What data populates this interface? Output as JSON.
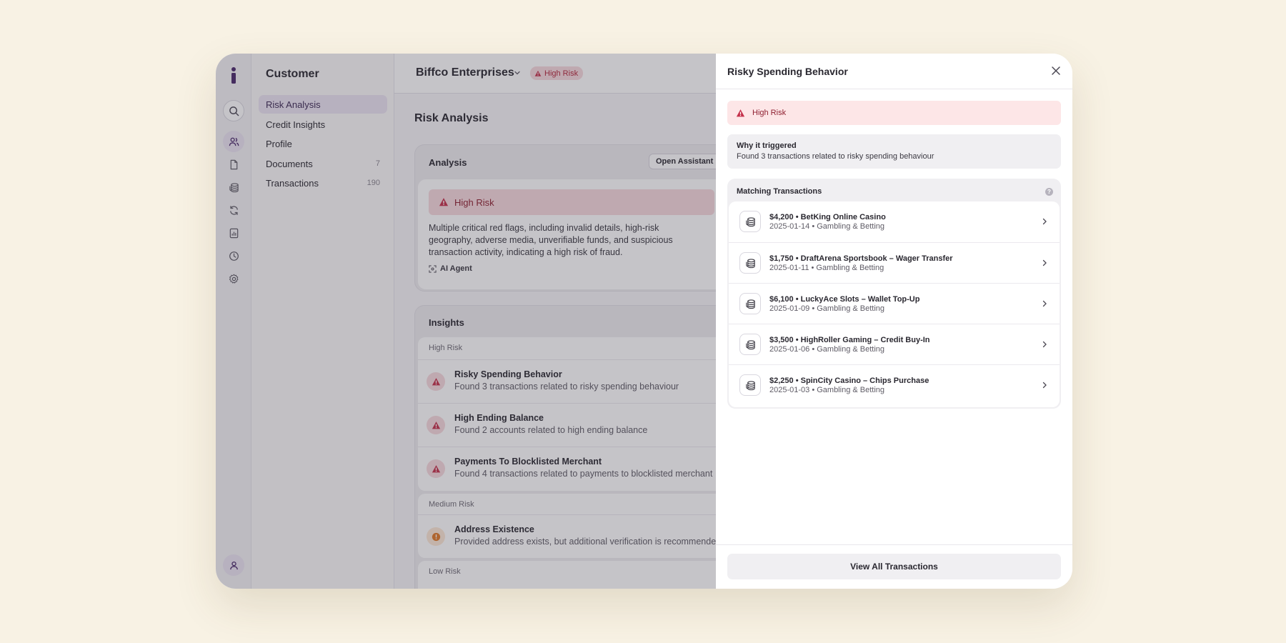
{
  "rail": {
    "icons": [
      "info-logo-icon",
      "search-icon",
      "users-icon",
      "document-icon",
      "coins-icon",
      "refresh-icon",
      "report-icon",
      "clock-icon",
      "gear-icon",
      "user-icon"
    ],
    "brand_color": "#4b2a6b"
  },
  "nav": {
    "title": "Customer",
    "items": [
      {
        "label": "Risk Analysis",
        "count": "",
        "active": true
      },
      {
        "label": "Credit Insights",
        "count": ""
      },
      {
        "label": "Profile",
        "count": ""
      },
      {
        "label": "Documents",
        "count": "7"
      },
      {
        "label": "Transactions",
        "count": "190"
      }
    ]
  },
  "header": {
    "company": "Biffco Enterprises",
    "risk_badge": "High Risk"
  },
  "main": {
    "title": "Risk Analysis",
    "analysis": {
      "heading": "Analysis",
      "button": "Open Assistant",
      "risk_level": "High Risk",
      "description": "Multiple critical red flags, including invalid details, high-risk geography, adverse media, unverifiable funds, and suspicious transaction activity, indicating a high risk of fraud.",
      "agent": "AI Agent"
    },
    "insights": {
      "heading": "Insights",
      "groups": [
        {
          "label": "High Risk",
          "items": [
            {
              "title": "Risky Spending Behavior",
              "desc": "Found 3 transactions related to risky spending behaviour"
            },
            {
              "title": "High Ending Balance",
              "desc": "Found 2 accounts related to high ending balance"
            },
            {
              "title": "Payments To Blocklisted Merchant",
              "desc": "Found 4 transactions related to payments to blocklisted merchant"
            }
          ]
        },
        {
          "label": "Medium Risk",
          "items": [
            {
              "title": "Address Existence",
              "desc": "Provided address exists, but additional verification is recommended"
            }
          ]
        },
        {
          "label": "Low Risk",
          "items": []
        }
      ]
    }
  },
  "drawer": {
    "title": "Risky Spending Behavior",
    "risk_label": "High Risk",
    "why_title": "Why it triggered",
    "why_desc": "Found 3 transactions related to risky spending behaviour",
    "matching_title": "Matching Transactions",
    "help": "?",
    "transactions": [
      {
        "amount_merchant": "$4,200 • BetKing Online Casino",
        "meta": "2025-01-14 • Gambling & Betting"
      },
      {
        "amount_merchant": "$1,750 • DraftArena Sportsbook – Wager Transfer",
        "meta": "2025-01-11 • Gambling & Betting"
      },
      {
        "amount_merchant": "$6,100 • LuckyAce Slots – Wallet Top-Up",
        "meta": "2025-01-09 • Gambling & Betting"
      },
      {
        "amount_merchant": "$3,500 • HighRoller Gaming – Credit Buy-In",
        "meta": "2025-01-06 • Gambling & Betting"
      },
      {
        "amount_merchant": "$2,250 • SpinCity Casino – Chips Purchase",
        "meta": "2025-01-03 • Gambling & Betting"
      }
    ],
    "footer_button": "View All Transactions"
  },
  "colors": {
    "high_risk_bg": "#f7dadd",
    "high_risk_text": "#b3263c",
    "medium_risk": "#e07a2a",
    "accent_purple": "#ece5f3"
  }
}
